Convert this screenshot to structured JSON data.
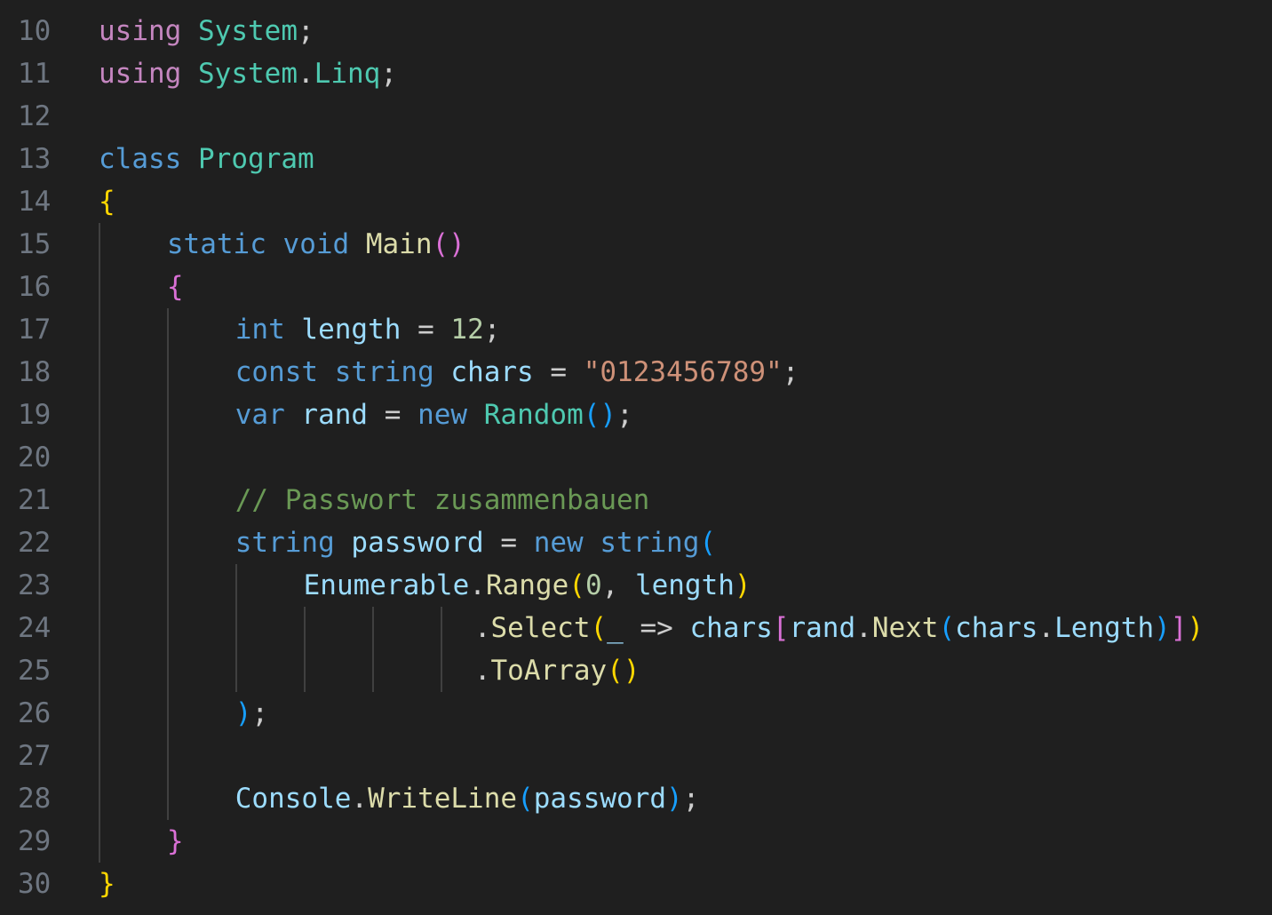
{
  "editor": {
    "language": "csharp",
    "theme_colors": {
      "background": "#1f1f1f",
      "line_number": "#6e7681",
      "default": "#cccccc",
      "keyword_control": "#c586c0",
      "keyword": "#569cd6",
      "type": "#4ec9b0",
      "variable": "#9cdcfe",
      "function": "#dcdcaa",
      "number": "#b5cea8",
      "string": "#ce9178",
      "comment": "#6a9955",
      "bracket_level_1": "#ffd700",
      "bracket_level_2": "#da70d6",
      "bracket_level_3": "#179fff"
    },
    "lines": [
      {
        "num": "10",
        "indent": 0,
        "tokens": [
          {
            "t": "using",
            "c": "kw-ctrl"
          },
          {
            "t": " ",
            "c": "punc"
          },
          {
            "t": "System",
            "c": "type"
          },
          {
            "t": ";",
            "c": "punc"
          }
        ]
      },
      {
        "num": "11",
        "indent": 0,
        "tokens": [
          {
            "t": "using",
            "c": "kw-ctrl"
          },
          {
            "t": " ",
            "c": "punc"
          },
          {
            "t": "System",
            "c": "type"
          },
          {
            "t": ".",
            "c": "punc"
          },
          {
            "t": "Linq",
            "c": "type"
          },
          {
            "t": ";",
            "c": "punc"
          }
        ]
      },
      {
        "num": "12",
        "indent": 0,
        "tokens": []
      },
      {
        "num": "13",
        "indent": 0,
        "tokens": [
          {
            "t": "class",
            "c": "kw"
          },
          {
            "t": " ",
            "c": "punc"
          },
          {
            "t": "Program",
            "c": "type"
          }
        ]
      },
      {
        "num": "14",
        "indent": 0,
        "tokens": [
          {
            "t": "{",
            "c": "b1"
          }
        ]
      },
      {
        "num": "15",
        "indent": 4,
        "tokens": [
          {
            "t": "static",
            "c": "kw"
          },
          {
            "t": " ",
            "c": "punc"
          },
          {
            "t": "void",
            "c": "kw"
          },
          {
            "t": " ",
            "c": "punc"
          },
          {
            "t": "Main",
            "c": "fn"
          },
          {
            "t": "()",
            "c": "b2"
          }
        ]
      },
      {
        "num": "16",
        "indent": 4,
        "tokens": [
          {
            "t": "{",
            "c": "b2"
          }
        ]
      },
      {
        "num": "17",
        "indent": 8,
        "tokens": [
          {
            "t": "int",
            "c": "kw"
          },
          {
            "t": " ",
            "c": "punc"
          },
          {
            "t": "length",
            "c": "var"
          },
          {
            "t": " = ",
            "c": "punc"
          },
          {
            "t": "12",
            "c": "num"
          },
          {
            "t": ";",
            "c": "punc"
          }
        ]
      },
      {
        "num": "18",
        "indent": 8,
        "tokens": [
          {
            "t": "const",
            "c": "kw"
          },
          {
            "t": " ",
            "c": "punc"
          },
          {
            "t": "string",
            "c": "kw"
          },
          {
            "t": " ",
            "c": "punc"
          },
          {
            "t": "chars",
            "c": "var"
          },
          {
            "t": " = ",
            "c": "punc"
          },
          {
            "t": "\"0123456789\"",
            "c": "str"
          },
          {
            "t": ";",
            "c": "punc"
          }
        ]
      },
      {
        "num": "19",
        "indent": 8,
        "tokens": [
          {
            "t": "var",
            "c": "kw"
          },
          {
            "t": " ",
            "c": "punc"
          },
          {
            "t": "rand",
            "c": "var"
          },
          {
            "t": " = ",
            "c": "punc"
          },
          {
            "t": "new",
            "c": "kw"
          },
          {
            "t": " ",
            "c": "punc"
          },
          {
            "t": "Random",
            "c": "type"
          },
          {
            "t": "()",
            "c": "b3"
          },
          {
            "t": ";",
            "c": "punc"
          }
        ]
      },
      {
        "num": "20",
        "indent": 0,
        "tokens": []
      },
      {
        "num": "21",
        "indent": 8,
        "tokens": [
          {
            "t": "// Passwort zusammenbauen",
            "c": "cmt"
          }
        ]
      },
      {
        "num": "22",
        "indent": 8,
        "tokens": [
          {
            "t": "string",
            "c": "kw"
          },
          {
            "t": " ",
            "c": "punc"
          },
          {
            "t": "password",
            "c": "var"
          },
          {
            "t": " = ",
            "c": "punc"
          },
          {
            "t": "new",
            "c": "kw"
          },
          {
            "t": " ",
            "c": "punc"
          },
          {
            "t": "string",
            "c": "kw"
          },
          {
            "t": "(",
            "c": "b3"
          }
        ]
      },
      {
        "num": "23",
        "indent": 12,
        "tokens": [
          {
            "t": "Enumerable",
            "c": "var"
          },
          {
            "t": ".",
            "c": "punc"
          },
          {
            "t": "Range",
            "c": "fn"
          },
          {
            "t": "(",
            "c": "b1"
          },
          {
            "t": "0",
            "c": "num"
          },
          {
            "t": ", ",
            "c": "punc"
          },
          {
            "t": "length",
            "c": "var"
          },
          {
            "t": ")",
            "c": "b1"
          }
        ]
      },
      {
        "num": "24",
        "indent": 22,
        "tokens": [
          {
            "t": ".",
            "c": "punc"
          },
          {
            "t": "Select",
            "c": "fn"
          },
          {
            "t": "(",
            "c": "b1"
          },
          {
            "t": "_",
            "c": "var"
          },
          {
            "t": " => ",
            "c": "punc"
          },
          {
            "t": "chars",
            "c": "var"
          },
          {
            "t": "[",
            "c": "b2"
          },
          {
            "t": "rand",
            "c": "var"
          },
          {
            "t": ".",
            "c": "punc"
          },
          {
            "t": "Next",
            "c": "fn"
          },
          {
            "t": "(",
            "c": "b3"
          },
          {
            "t": "chars",
            "c": "var"
          },
          {
            "t": ".",
            "c": "punc"
          },
          {
            "t": "Length",
            "c": "var"
          },
          {
            "t": ")",
            "c": "b3"
          },
          {
            "t": "]",
            "c": "b2"
          },
          {
            "t": ")",
            "c": "b1"
          }
        ]
      },
      {
        "num": "25",
        "indent": 22,
        "tokens": [
          {
            "t": ".",
            "c": "punc"
          },
          {
            "t": "ToArray",
            "c": "fn"
          },
          {
            "t": "()",
            "c": "b1"
          }
        ]
      },
      {
        "num": "26",
        "indent": 8,
        "tokens": [
          {
            "t": ")",
            "c": "b3"
          },
          {
            "t": ";",
            "c": "punc"
          }
        ]
      },
      {
        "num": "27",
        "indent": 0,
        "tokens": []
      },
      {
        "num": "28",
        "indent": 8,
        "tokens": [
          {
            "t": "Console",
            "c": "var"
          },
          {
            "t": ".",
            "c": "punc"
          },
          {
            "t": "WriteLine",
            "c": "fn"
          },
          {
            "t": "(",
            "c": "b3"
          },
          {
            "t": "password",
            "c": "var"
          },
          {
            "t": ")",
            "c": "b3"
          },
          {
            "t": ";",
            "c": "punc"
          }
        ]
      },
      {
        "num": "29",
        "indent": 4,
        "tokens": [
          {
            "t": "}",
            "c": "b2"
          }
        ]
      },
      {
        "num": "30",
        "indent": 0,
        "tokens": [
          {
            "t": "}",
            "c": "b1"
          }
        ]
      }
    ]
  }
}
